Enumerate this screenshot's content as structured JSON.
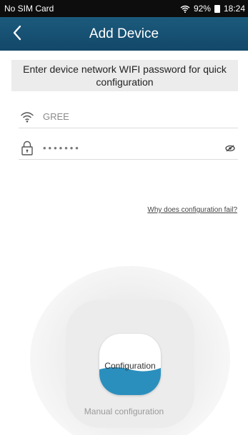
{
  "status_bar": {
    "carrier": "No SIM Card",
    "battery": "92%",
    "time": "18:24"
  },
  "header": {
    "title": "Add Device",
    "back_icon": "chevron-left-icon"
  },
  "notice": {
    "text": "Enter device network WIFI password for quick configuration"
  },
  "wifi_field": {
    "icon": "wifi-icon",
    "value": "GREE"
  },
  "password_field": {
    "icon": "lock-icon",
    "value": "•••••••",
    "toggle_icon": "eye-icon"
  },
  "help_link": "Why does configuration fail?",
  "config_button": {
    "label": "Configuration",
    "wave_color": "#2b8fbd"
  },
  "manual_link": "Manual configuration",
  "colors": {
    "header": "#1b5a7c",
    "accent": "#2b8fbd"
  }
}
